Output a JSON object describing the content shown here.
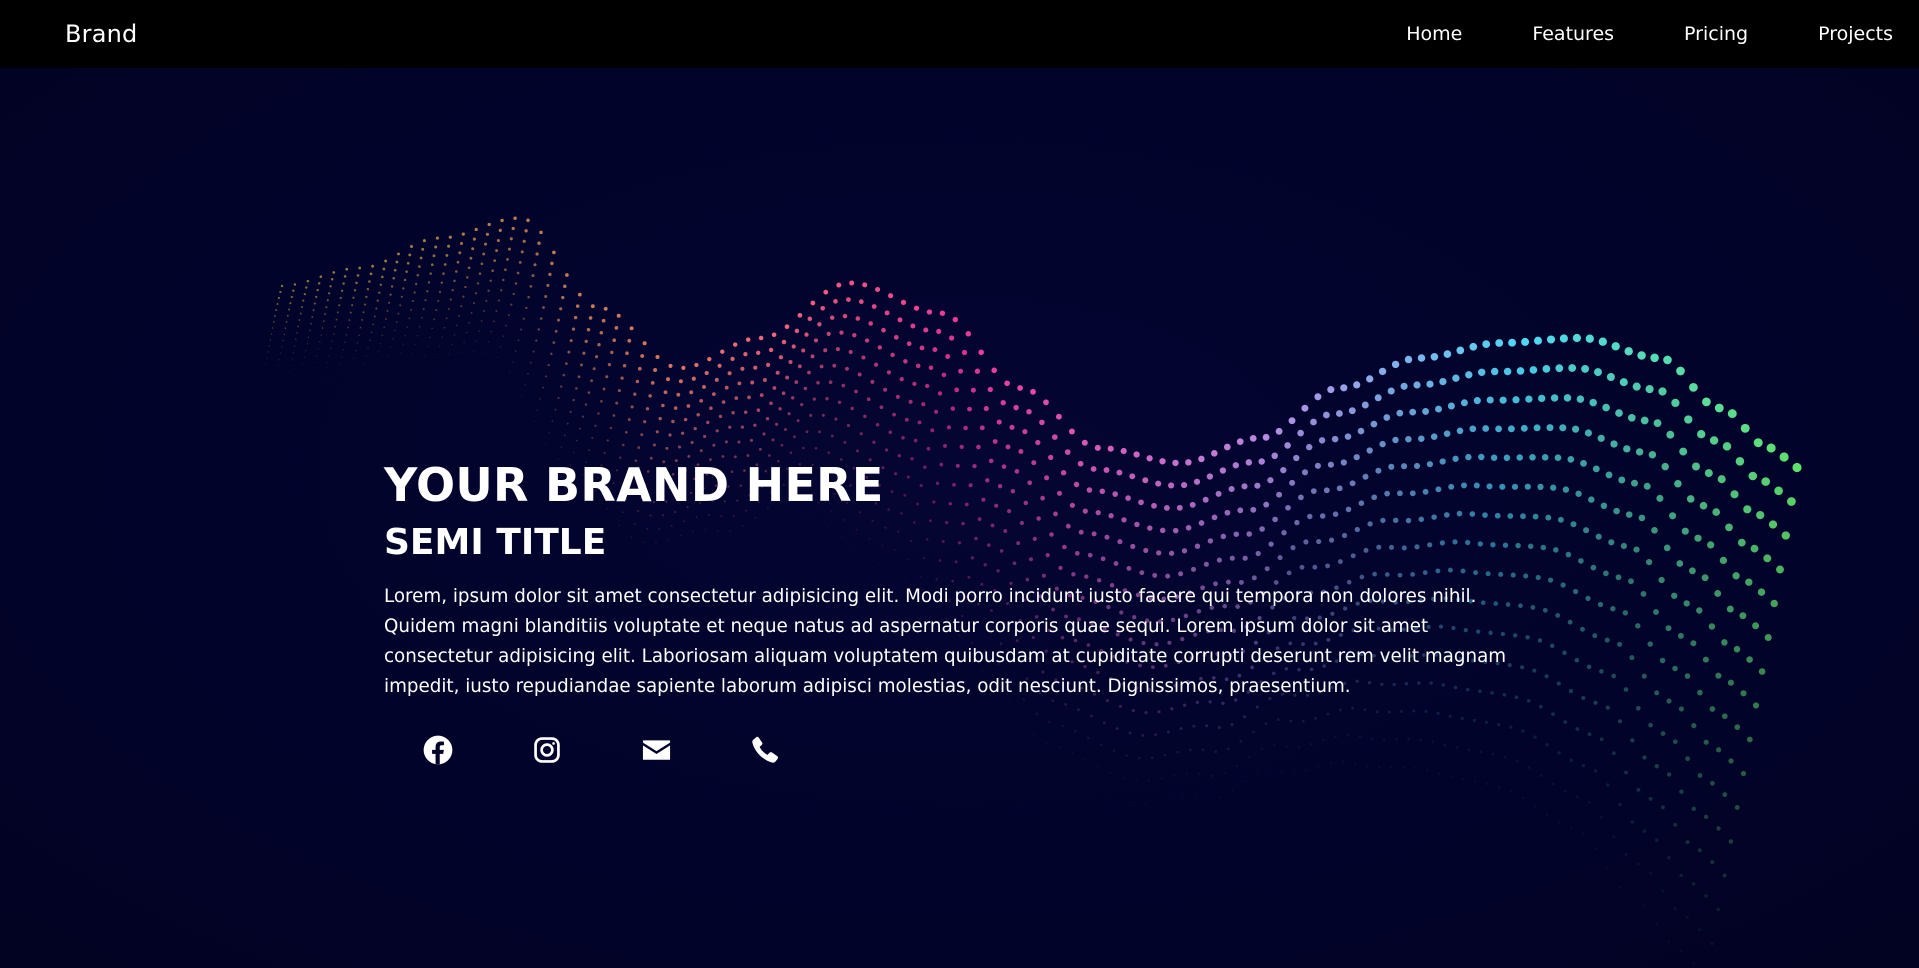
{
  "navbar": {
    "brand": "Brand",
    "links": [
      "Home",
      "Features",
      "Pricing",
      "Projects"
    ]
  },
  "hero": {
    "title": "YOUR BRAND HERE",
    "subtitle": "SEMI TITLE",
    "paragraph": "Lorem, ipsum dolor sit amet consectetur adipisicing elit. Modi porro incidunt iusto facere qui tempora non dolores nihil. Quidem magni blanditiis voluptate et neque natus ad aspernatur corporis quae sequi. Lorem ipsum dolor sit amet consectetur adipisicing elit. Laboriosam aliquam voluptatem quibusdam at cupiditate corrupti deserunt rem velit magnam impedit, iusto repudiandae sapiente laborum adipisci molestias, odit nesciunt. Dignissimos, praesentium."
  },
  "socials": [
    {
      "icon": "facebook-icon"
    },
    {
      "icon": "instagram-icon"
    },
    {
      "icon": "envelope-icon"
    },
    {
      "icon": "phone-icon"
    }
  ],
  "colors": {
    "navbar_bg": "#000000",
    "hero_bg": "#02032a",
    "text": "#ffffff",
    "wave_yellow": "#f5d442",
    "wave_orange": "#f59060",
    "wave_pink": "#f0359a",
    "wave_purple": "#b68ae0",
    "wave_cyan": "#4dd8f5",
    "wave_green": "#5fe06a"
  }
}
